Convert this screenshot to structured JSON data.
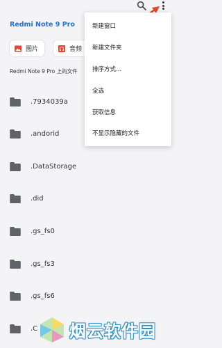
{
  "device": {
    "title": "Redmi Note 9 Pro"
  },
  "toolbar": {
    "search_icon": "search-icon",
    "more_icon": "more-vert-icon"
  },
  "chips": [
    {
      "label": "图片",
      "icon": "image-icon",
      "color": "#e8452c"
    },
    {
      "label": "音频",
      "icon": "headphones-icon",
      "color": "#e8452c"
    }
  ],
  "section": {
    "label": "Redmi Note 9 Pro 上的文件"
  },
  "folders": [
    {
      "name": ".7934039a"
    },
    {
      "name": ".andorid"
    },
    {
      "name": ".DataStorage"
    },
    {
      "name": ".did"
    },
    {
      "name": ".gs_fs0"
    },
    {
      "name": ".gs_fs3"
    },
    {
      "name": ".gs_fs6"
    },
    {
      "name": ".C"
    }
  ],
  "menu": {
    "items": [
      {
        "label": "新建窗口"
      },
      {
        "label": "新建文件夹"
      },
      {
        "label": "排序方式..."
      },
      {
        "label": "全选"
      },
      {
        "label": "获取信息"
      },
      {
        "label": "不显示隐藏的文件"
      }
    ]
  },
  "watermark": {
    "text": "烟云软件园"
  },
  "colors": {
    "accent": "#1a73e8",
    "folder": "#5f6368",
    "arrow": "#e8452c"
  }
}
